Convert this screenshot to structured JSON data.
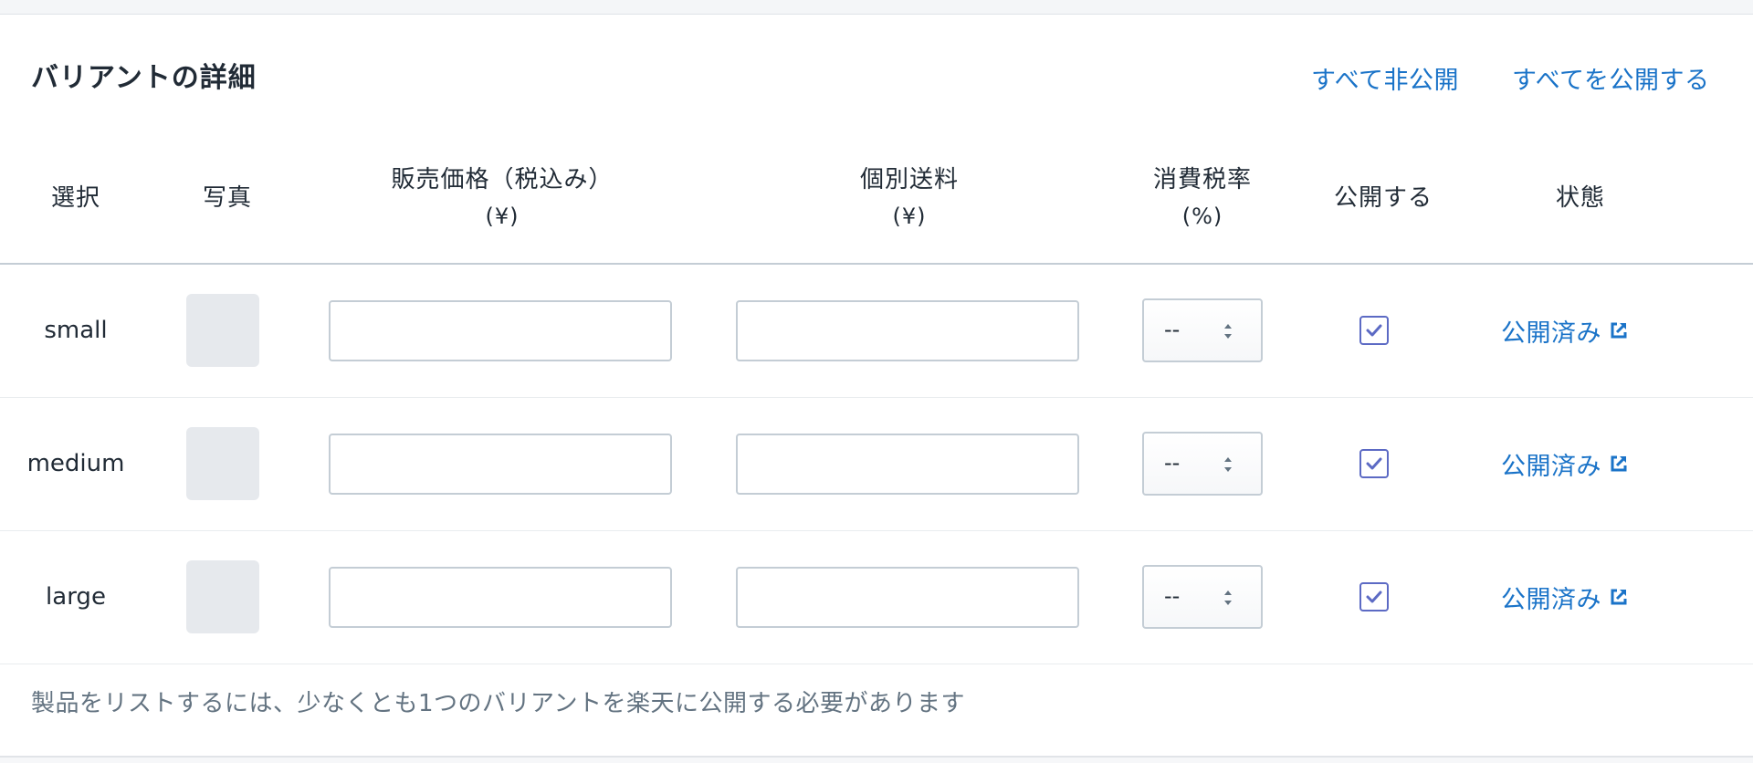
{
  "header": {
    "title": "バリアントの詳細",
    "unpublish_all": "すべて非公開",
    "publish_all": "すべてを公開する"
  },
  "columns": {
    "select": "選択",
    "photo": "写真",
    "price": "販売価格（税込み）",
    "price_unit": "(¥)",
    "shipping": "個別送料",
    "shipping_unit": "(¥)",
    "tax": "消費税率",
    "tax_unit": "(%)",
    "publish": "公開する",
    "status": "状態"
  },
  "rows": [
    {
      "name": "small",
      "price": "",
      "shipping": "",
      "tax": "--",
      "publish_checked": true,
      "status": "公開済み"
    },
    {
      "name": "medium",
      "price": "",
      "shipping": "",
      "tax": "--",
      "publish_checked": true,
      "status": "公開済み"
    },
    {
      "name": "large",
      "price": "",
      "shipping": "",
      "tax": "--",
      "publish_checked": true,
      "status": "公開済み"
    }
  ],
  "footnote": "製品をリストするには、少なくとも1つのバリアントを楽天に公開する必要があります",
  "icons": {
    "status": "external-link-icon",
    "select": "chevron-up-down-icon",
    "checkbox": "checkmark-icon"
  },
  "colors": {
    "link": "#1a73c8",
    "checkbox": "#5c6ac4",
    "muted_text": "#637381"
  }
}
